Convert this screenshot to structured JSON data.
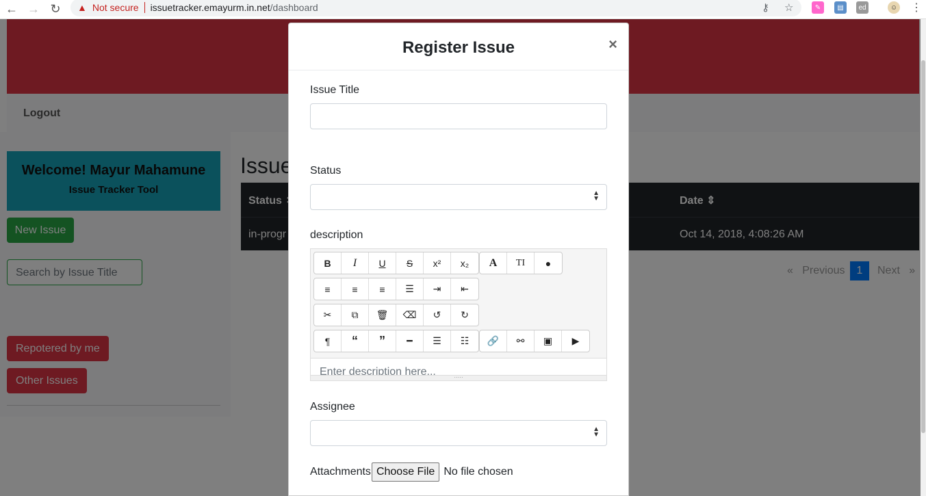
{
  "browser": {
    "not_secure": "Not secure",
    "url_host": "issuetracker.emayurm.in.net",
    "url_path": "/dashboard"
  },
  "page": {
    "logout": "Logout",
    "welcome_title": "Welcome! Mayur Mahamune",
    "welcome_sub": "Issue Tracker Tool",
    "new_issue": "New Issue",
    "search_placeholder": "Search by Issue Title",
    "reported_by_me": "Repotered by me",
    "other_issues": "Other Issues",
    "issues_heading": "Issue",
    "table": {
      "headers": [
        "Status",
        "Date"
      ],
      "row": {
        "status": "in-progr",
        "date": "Oct 14, 2018, 4:08:26 AM"
      }
    },
    "pagination": {
      "previous": "Previous",
      "current": "1",
      "next": "Next"
    }
  },
  "modal": {
    "title": "Register Issue",
    "close": "×",
    "issue_title_label": "Issue Title",
    "issue_title_value": "",
    "status_label": "Status",
    "status_value": "",
    "description_label": "description",
    "description_placeholder": "Enter description here...",
    "assignee_label": "Assignee",
    "assignee_value": "",
    "attachments_label": "Attachments",
    "choose_file": "Choose File",
    "file_status": "No file chosen"
  },
  "colors": {
    "danger": "#dc3545",
    "success": "#28a745",
    "info": "#17a2b8",
    "dark": "#212529",
    "primary": "#007bff"
  }
}
